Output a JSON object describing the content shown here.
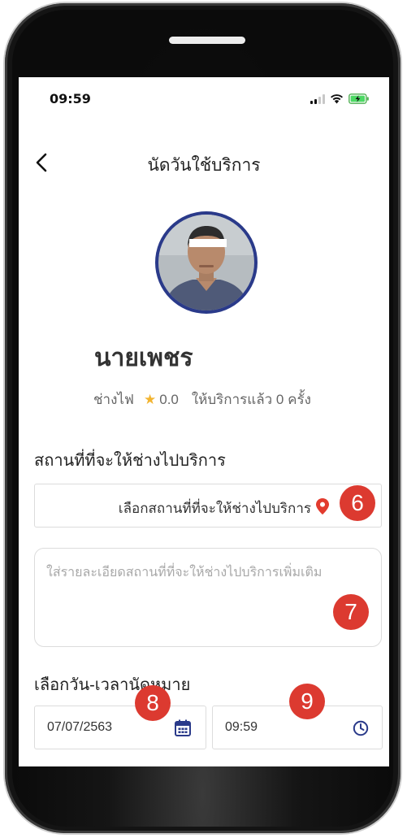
{
  "status_bar": {
    "time": "09:59",
    "signal_icon": "signal-bars-icon",
    "wifi_icon": "wifi-icon",
    "battery_icon": "battery-charging-icon"
  },
  "header": {
    "back_icon": "chevron-left-icon",
    "title": "นัดวันใช้บริการ"
  },
  "provider": {
    "name": "นายเพชร",
    "occupation": "ช่างไฟ",
    "rating": "0.0",
    "served_text": "ให้บริการแล้ว 0 ครั้ง"
  },
  "location_section": {
    "label": "สถานที่ที่จะให้ช่างไปบริการ",
    "select_text": "เลือกสถานที่ที่จะให้ช่างไปบริการ",
    "pin_icon": "map-pin-icon",
    "details_placeholder": "ใส่รายละเอียดสถานที่ที่จะให้ช่างไปบริการเพิ่มเติม"
  },
  "schedule_section": {
    "label": "เลือกวัน-เวลานัดหมาย",
    "date_value": "07/07/2563",
    "date_icon": "calendar-icon",
    "time_value": "09:59",
    "time_icon": "clock-icon"
  },
  "badges": {
    "b6": "6",
    "b7": "7",
    "b8": "8",
    "b9": "9"
  },
  "colors": {
    "accent_blue": "#2a3a8a",
    "badge_red": "#dc3a30",
    "pin_red": "#e23b2e",
    "star_yellow": "#f2b430"
  }
}
